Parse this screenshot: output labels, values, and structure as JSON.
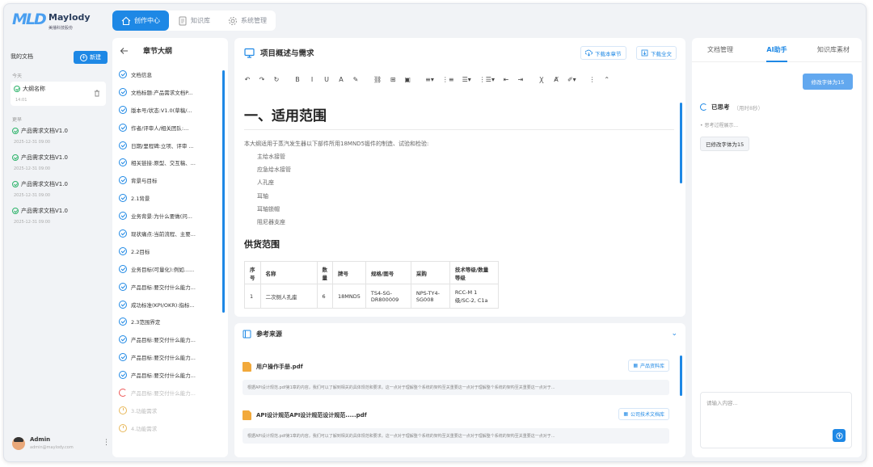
{
  "brand": {
    "mark": "MLD",
    "name": "Maylody",
    "sub": "美播科技股份"
  },
  "nav": [
    {
      "label": "创作中心",
      "icon": "home-icon",
      "active": true
    },
    {
      "label": "知识库",
      "icon": "document-icon",
      "active": false
    },
    {
      "label": "系统管理",
      "icon": "gear-icon",
      "active": false
    }
  ],
  "sidebar": {
    "title": "我的文档",
    "new_label": "新建",
    "today_label": "今天",
    "earlier_label": "更早",
    "today_docs": [
      {
        "title": "大纲名称",
        "date": "14:01"
      }
    ],
    "earlier_docs": [
      {
        "title": "产品需求文档V1.0",
        "date": "2025-12-31 09:00"
      },
      {
        "title": "产品需求文档V1.0",
        "date": "2025-12-31 09:00"
      },
      {
        "title": "产品需求文档V1.0",
        "date": "2025-12-31 09:00"
      },
      {
        "title": "产品需求文档V1.0",
        "date": "2025-12-31 09:00"
      }
    ],
    "user": {
      "name": "Admin",
      "email": "admin@maylody.com"
    }
  },
  "outline": {
    "title": "章节大纲",
    "items": [
      {
        "label": "文档信息",
        "status": "done"
      },
      {
        "label": "文档标题:产品需求文档P...",
        "status": "done"
      },
      {
        "label": "版本号/状态:V1.0(草稿/...",
        "status": "done"
      },
      {
        "label": "作者/评审人/相关团队:...",
        "status": "done"
      },
      {
        "label": "日期/里程碑:立项、评审 ...",
        "status": "done"
      },
      {
        "label": "相关链接:原型、交互稿、...",
        "status": "done"
      },
      {
        "label": "背景与目标",
        "status": "done"
      },
      {
        "label": "2.1背景",
        "status": "done"
      },
      {
        "label": "业务背景:为什么要做(问...",
        "status": "done"
      },
      {
        "label": "现状痛点:当前流程、主要...",
        "status": "done"
      },
      {
        "label": "2.2目标",
        "status": "done"
      },
      {
        "label": "业务目标(可量化):例如......",
        "status": "done"
      },
      {
        "label": "产品目标:要交付什么能力...",
        "status": "done"
      },
      {
        "label": "成功标准(KPI/OKR):指标...",
        "status": "done"
      },
      {
        "label": "2.3范围界定",
        "status": "done"
      },
      {
        "label": "产品目标:要交付什么能力...",
        "status": "done"
      },
      {
        "label": "产品目标:要交付什么能力...",
        "status": "done"
      },
      {
        "label": "产品目标:要交付什么能力...",
        "status": "done"
      },
      {
        "label": "产品目标:要交付什么能力...",
        "status": "progress"
      },
      {
        "label": "3.功能需求",
        "status": "pending"
      },
      {
        "label": "4.功能需求",
        "status": "pending"
      }
    ]
  },
  "editor": {
    "title": "项目概述与需求",
    "btn_download_chapter": "下载本章节",
    "btn_download_all": "下载全文",
    "toolbar": [
      "↶",
      "↷",
      "↻",
      "B",
      "I",
      "U",
      "A",
      "✎",
      "⛓",
      "⊞",
      "▣",
      "≡▾",
      "⋮≡",
      "☰▾",
      "⋮☰▾",
      "⇤",
      "⇥",
      "Ꭓ",
      "Ⱥ",
      "✐▾",
      "⋮",
      "⌃"
    ],
    "h1": "一、适用范围",
    "paragraph": "本大纲适用于蒸汽发生器以下部件所用18MND5锻件的制造、试验和检验:",
    "list": [
      "主给水接管",
      "应急给水接管",
      "人孔座",
      "耳轴",
      "耳轴锁帽",
      "阻尼器支座"
    ],
    "h2": "供货范围",
    "table": {
      "headers": [
        "序号",
        "名称",
        "数量",
        "牌号",
        "规格/图号",
        "采购",
        "技术等级/数量等级"
      ],
      "rows": [
        [
          "1",
          "二次侧人孔座",
          "6",
          "18MND5",
          "TS4-SG-DR800009",
          "NPS-TY4-SG008",
          "RCC-M 1级/SC-2, C1a"
        ]
      ]
    }
  },
  "refs": {
    "title": "参考来源",
    "items": [
      {
        "name": "用户操作手册.pdf",
        "tag": "产品资料库",
        "snippet": "根据API设计规范.pdf第1章的内容，我们可以了解到相关的具体规范和要求。这一点对于理解整个系统的架构至关重要这一点对于理解整个系统的架构至关重要这一点对于..."
      },
      {
        "name": "API设计规范API设计规范设计规范.....pdf",
        "tag": "公司技术文档库",
        "snippet": "根据API设计规范.pdf第1章的内容，我们可以了解到相关的具体规范和要求。这一点对于理解整个系统的架构至关重要这一点对于理解整个系统的架构至关重要这一点对于..."
      }
    ]
  },
  "right": {
    "tabs": [
      {
        "label": "文档管理",
        "active": false
      },
      {
        "label": "AI助手",
        "active": true
      },
      {
        "label": "知识库素材",
        "active": false
      }
    ],
    "user_bubble": "修改字体为15",
    "think_label": "已思考",
    "think_time": "（用时8秒）",
    "think_process": "• 思考过程展示...",
    "reply": "已修改字体为15",
    "input_placeholder": "请输入内容..."
  }
}
